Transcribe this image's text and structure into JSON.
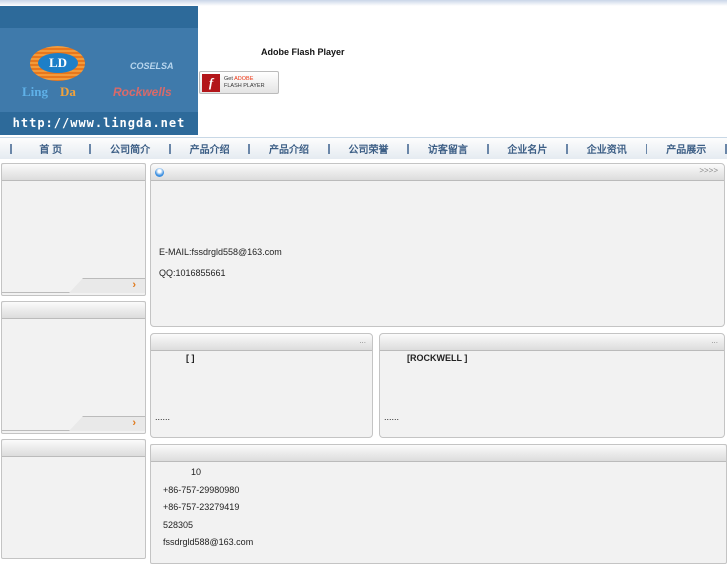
{
  "banner": {
    "logo_text": "LD",
    "logo_sub": "Ling",
    "logo_sub2": "Da",
    "brand1": "COSELSA",
    "brand2": "Rockwells",
    "url": "http://www.lingda.net"
  },
  "flash": {
    "title": "Adobe Flash Player",
    "button_get": "Get",
    "button_adobe": "ADOBE",
    "button_flash": "FLASH PLAYER"
  },
  "nav": [
    "首 页",
    "公司简介",
    "产品介绍",
    "产品介绍",
    "公司荣誉",
    "访客留言",
    "企业名片",
    "企业资讯",
    "产品展示"
  ],
  "main": {
    "more": ">>>>",
    "email": "E-MAIL:fssdrgld558@163.com",
    "qq": "QQ:1016855661"
  },
  "panel_left": {
    "bracket": "[      ]",
    "ellipsis": "......",
    "more": "..."
  },
  "panel_right": {
    "bracket": "[ROCKWELL    ]",
    "ellipsis": "......",
    "more": "..."
  },
  "contact": {
    "line1": "10",
    "phone": "+86-757-29980980",
    "fax": "+86-757-23279419",
    "zip": "528305",
    "email": "fssdrgld588@163.com"
  },
  "sidebar": {
    "arrow": "›"
  }
}
